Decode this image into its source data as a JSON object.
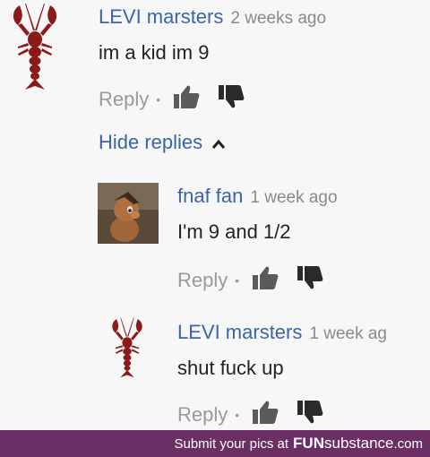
{
  "comments": [
    {
      "author": "LEVI marsters",
      "time": "2 weeks ago",
      "text": "im a kid im 9",
      "reply_label": "Reply",
      "avatar_icon": "lobster-icon"
    },
    {
      "author": "fnaf fan",
      "time": "1 week ago",
      "text": "I'm 9 and 1/2",
      "reply_label": "Reply",
      "avatar_icon": "pony-avatar"
    },
    {
      "author": "LEVI marsters",
      "time": "1 week ag",
      "text": "shut fuck up",
      "reply_label": "Reply",
      "avatar_icon": "lobster-icon"
    }
  ],
  "hide_replies_label": "Hide replies",
  "footer": {
    "prefix": "Submit your pics at",
    "brand_main": "FUN",
    "brand_sub": "substance",
    "brand_tld": ".com"
  },
  "colors": {
    "author": "#3a64a8",
    "lobster": "#8b1a1a",
    "footer_bg": "#6b2f66"
  }
}
